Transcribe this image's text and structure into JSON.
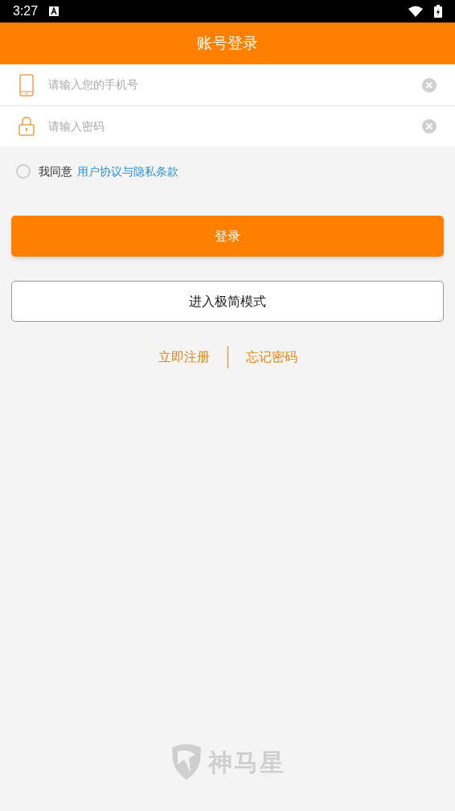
{
  "status_bar": {
    "time": "3:27"
  },
  "header": {
    "title": "账号登录"
  },
  "fields": [
    {
      "kind": "phone",
      "placeholder": "请输入您的手机号"
    },
    {
      "kind": "password",
      "placeholder": "请输入密码"
    }
  ],
  "agreement": {
    "checked": false,
    "text": "我同意",
    "link": "用户协议与隐私条款"
  },
  "login_button": "登录",
  "simple_mode_button": "进入极简模式",
  "links": [
    "立即注册",
    "忘记密码"
  ],
  "brand": "神马星"
}
